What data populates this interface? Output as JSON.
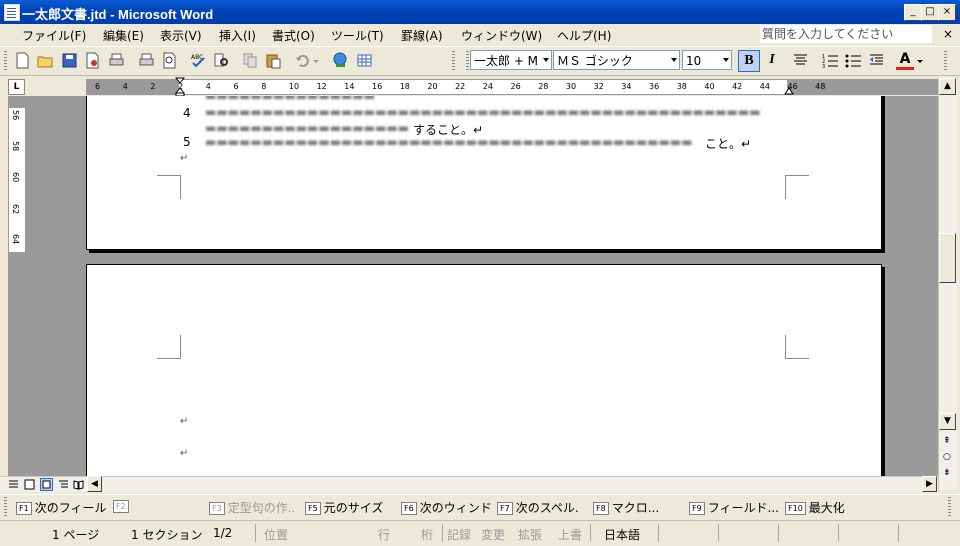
{
  "window": {
    "title": "一太郎文書.jtd - Microsoft Word",
    "min": "_",
    "max": "□",
    "close": "×"
  },
  "menu": {
    "items": [
      "ファイル(F)",
      "編集(E)",
      "表示(V)",
      "挿入(I)",
      "書式(O)",
      "ツール(T)",
      "罫線(A)",
      "ウィンドウ(W)",
      "ヘルプ(H)"
    ],
    "help_placeholder": "質問を入力してください",
    "close_doc": "×"
  },
  "toolbar": {
    "style_value": "一太郎 + M",
    "font_value": "ＭＳ ゴシック",
    "size_value": "10",
    "bold": "B",
    "italic": "I",
    "font_color_glyph": "A",
    "font_color": "#e0201b"
  },
  "ruler": {
    "ticks": [
      "6",
      "4",
      "2",
      "2",
      "4",
      "6",
      "8",
      "10",
      "12",
      "14",
      "16",
      "18",
      "20",
      "22",
      "24",
      "26",
      "28",
      "30",
      "32",
      "34",
      "36",
      "38",
      "40",
      "42",
      "44",
      "46",
      "48"
    ],
    "v_labels": [
      "56",
      "58",
      "60",
      "62",
      "64"
    ],
    "corner": "L"
  },
  "document": {
    "line_numbers": [
      "4",
      "5"
    ],
    "line4_tail": "すること。↵",
    "line5_tail": "こと。↵",
    "para_mark": "↵"
  },
  "fkeys": [
    {
      "key": "F1",
      "label": "次のフィール",
      "enabled": true
    },
    {
      "key": "F2",
      "label": "",
      "enabled": false
    },
    {
      "key": "F3",
      "label": "定型句の作..",
      "enabled": false
    },
    {
      "key": "F5",
      "label": "元のサイズ",
      "enabled": true
    },
    {
      "key": "F6",
      "label": "次のウィンド",
      "enabled": true
    },
    {
      "key": "F7",
      "label": "次のスペル.",
      "enabled": true
    },
    {
      "key": "F8",
      "label": "マクロ...",
      "enabled": true
    },
    {
      "key": "F9",
      "label": "フィールド...",
      "enabled": true
    },
    {
      "key": "F10",
      "label": "最大化",
      "enabled": true
    }
  ],
  "status": {
    "page": "1 ページ",
    "section": "1 セクション",
    "page_of": "1/2",
    "position": "位置",
    "line": "行",
    "column": "桁",
    "rec": "記録",
    "trk": "変更",
    "ext": "拡張",
    "ovr": "上書",
    "language": "日本語"
  }
}
